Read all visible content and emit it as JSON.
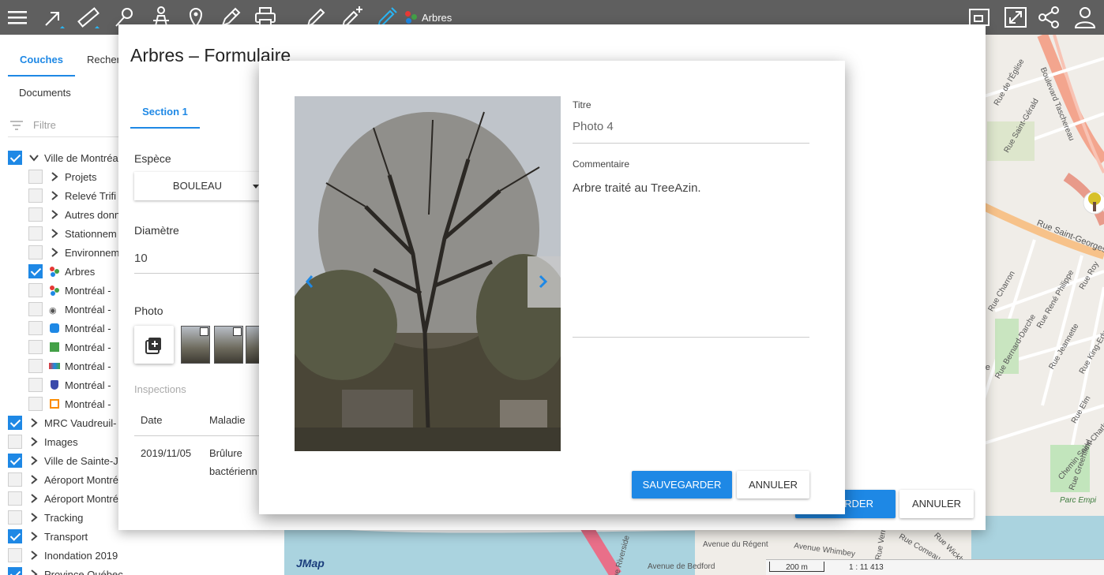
{
  "toolbar": {
    "icons": [
      "menu-icon",
      "select-arrow-icon",
      "measure-ruler-icon",
      "route-icon",
      "person-icon",
      "location-pin-icon",
      "edit-pencil-icon",
      "print-icon",
      "draw-icon",
      "draw-plus-icon",
      "draw-active-icon"
    ],
    "active_layer": "Arbres",
    "right_icons": [
      "window-icon",
      "fullscreen-icon",
      "share-icon",
      "user-icon"
    ],
    "accent": "#1e88e5"
  },
  "left_panel": {
    "tabs": {
      "couches": "Couches",
      "recherche": "Recher",
      "documents": "Documents"
    },
    "filter_placeholder": "Filtre",
    "layers": [
      {
        "label": "Ville de Montréa",
        "checked": true,
        "expanded": true,
        "indent": 0
      },
      {
        "label": "Projets",
        "checked": false,
        "indent": 1,
        "type": "group"
      },
      {
        "label": "Relevé Trifi",
        "checked": false,
        "indent": 1,
        "type": "group"
      },
      {
        "label": "Autres donn",
        "checked": false,
        "indent": 1,
        "type": "group"
      },
      {
        "label": "Stationnem",
        "checked": false,
        "indent": 1,
        "type": "group"
      },
      {
        "label": "Environnem",
        "checked": false,
        "indent": 1,
        "type": "group"
      },
      {
        "label": "Arbres",
        "checked": true,
        "indent": 1,
        "type": "dots"
      },
      {
        "label": "Montréal - ",
        "checked": false,
        "indent": 1,
        "type": "dots"
      },
      {
        "label": "Montréal - ",
        "checked": false,
        "indent": 1,
        "type": "bike"
      },
      {
        "label": "Montréal - ",
        "checked": false,
        "indent": 1,
        "type": "blue"
      },
      {
        "label": "Montréal - ",
        "checked": false,
        "indent": 1,
        "type": "green"
      },
      {
        "label": "Montréal - ",
        "checked": false,
        "indent": 1,
        "type": "multi"
      },
      {
        "label": "Montréal - ",
        "checked": false,
        "indent": 1,
        "type": "shield"
      },
      {
        "label": "Montréal - ",
        "checked": false,
        "indent": 1,
        "type": "orange"
      },
      {
        "label": "MRC Vaudreuil-",
        "checked": true,
        "indent": 0
      },
      {
        "label": "Images",
        "checked": false,
        "indent": 0
      },
      {
        "label": "Ville de Sainte-J",
        "checked": true,
        "indent": 0
      },
      {
        "label": "Aéroport Montré",
        "checked": false,
        "indent": 0
      },
      {
        "label": "Aéroport Montré",
        "checked": false,
        "indent": 0
      },
      {
        "label": "Tracking",
        "checked": false,
        "indent": 0
      },
      {
        "label": "Transport",
        "checked": true,
        "indent": 0
      },
      {
        "label": "Inondation 2019",
        "checked": false,
        "indent": 0
      },
      {
        "label": "Province Québec",
        "checked": true,
        "indent": 0
      }
    ]
  },
  "map": {
    "labels": [
      "Boulevard Taschereau",
      "Rue Saint-Gérald",
      "Rue de l'Église",
      "Rue Saint-Georges",
      "Rue Charron",
      "Rue René Philippe",
      "Rue Roy",
      "Rue Bernard-Darche",
      "Rue Jeannette",
      "Rue King-Edward",
      "Rue Elm",
      "Rue Greenfield",
      "Chemin Saint-Charles",
      "Parc Empi",
      "Avenue du Régent",
      "Avenue Whimbey",
      "Avenue de Bedford",
      "Rue Riverside",
      "Rue Wickham",
      "Rue Comeau",
      "Rue Vern",
      "ayne"
    ],
    "logo": "JMap",
    "scale_bar": "200 m",
    "scale_ratio": "1 : 11 413"
  },
  "form": {
    "title": "Arbres – Formulaire",
    "section_tab": "Section 1",
    "espece_label": "Espèce",
    "espece_value": "BOULEAU",
    "diametre_label": "Diamètre",
    "diametre_value": "10",
    "photo_label": "Photo",
    "inspections_label": "Inspections",
    "table": {
      "headers": [
        "Date",
        "Maladie"
      ],
      "rows": [
        {
          "date": "2019/11/05",
          "maladie_1": "Brûlure",
          "maladie_2": "bactérienn"
        }
      ]
    },
    "save_label": "SAUVEGARDER",
    "save_label_visible": "GARDER",
    "cancel_label": "ANNULER"
  },
  "photo_dialog": {
    "titre_label": "Titre",
    "titre_value": "Photo 4",
    "commentaire_label": "Commentaire",
    "commentaire_value": "Arbre traité au TreeAzin.",
    "save_label": "SAUVEGARDER",
    "cancel_label": "ANNULER"
  }
}
